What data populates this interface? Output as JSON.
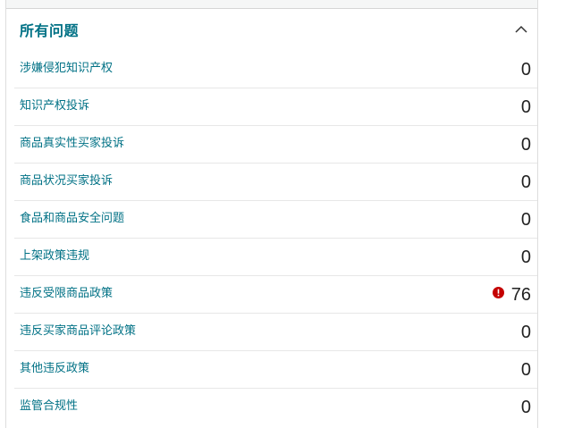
{
  "panel": {
    "title": "所有问题",
    "collapse_icon": "chevron-up-icon"
  },
  "colors": {
    "accent": "#007185",
    "alert": "#c40000",
    "text": "#222222"
  },
  "issues": [
    {
      "label": "涉嫌侵犯知识产权",
      "count": "0"
    },
    {
      "label": "知识产权投诉",
      "count": "0"
    },
    {
      "label": "商品真实性买家投诉",
      "count": "0"
    },
    {
      "label": "商品状况买家投诉",
      "count": "0"
    },
    {
      "label": "食品和商品安全问题",
      "count": "0"
    },
    {
      "label": "上架政策违规",
      "count": "0"
    },
    {
      "label": "违反受限商品政策",
      "count": "76",
      "alert": true
    },
    {
      "label": "违反买家商品评论政策",
      "count": "0"
    },
    {
      "label": "其他违反政策",
      "count": "0"
    },
    {
      "label": "监管合规性",
      "count": "0"
    }
  ]
}
